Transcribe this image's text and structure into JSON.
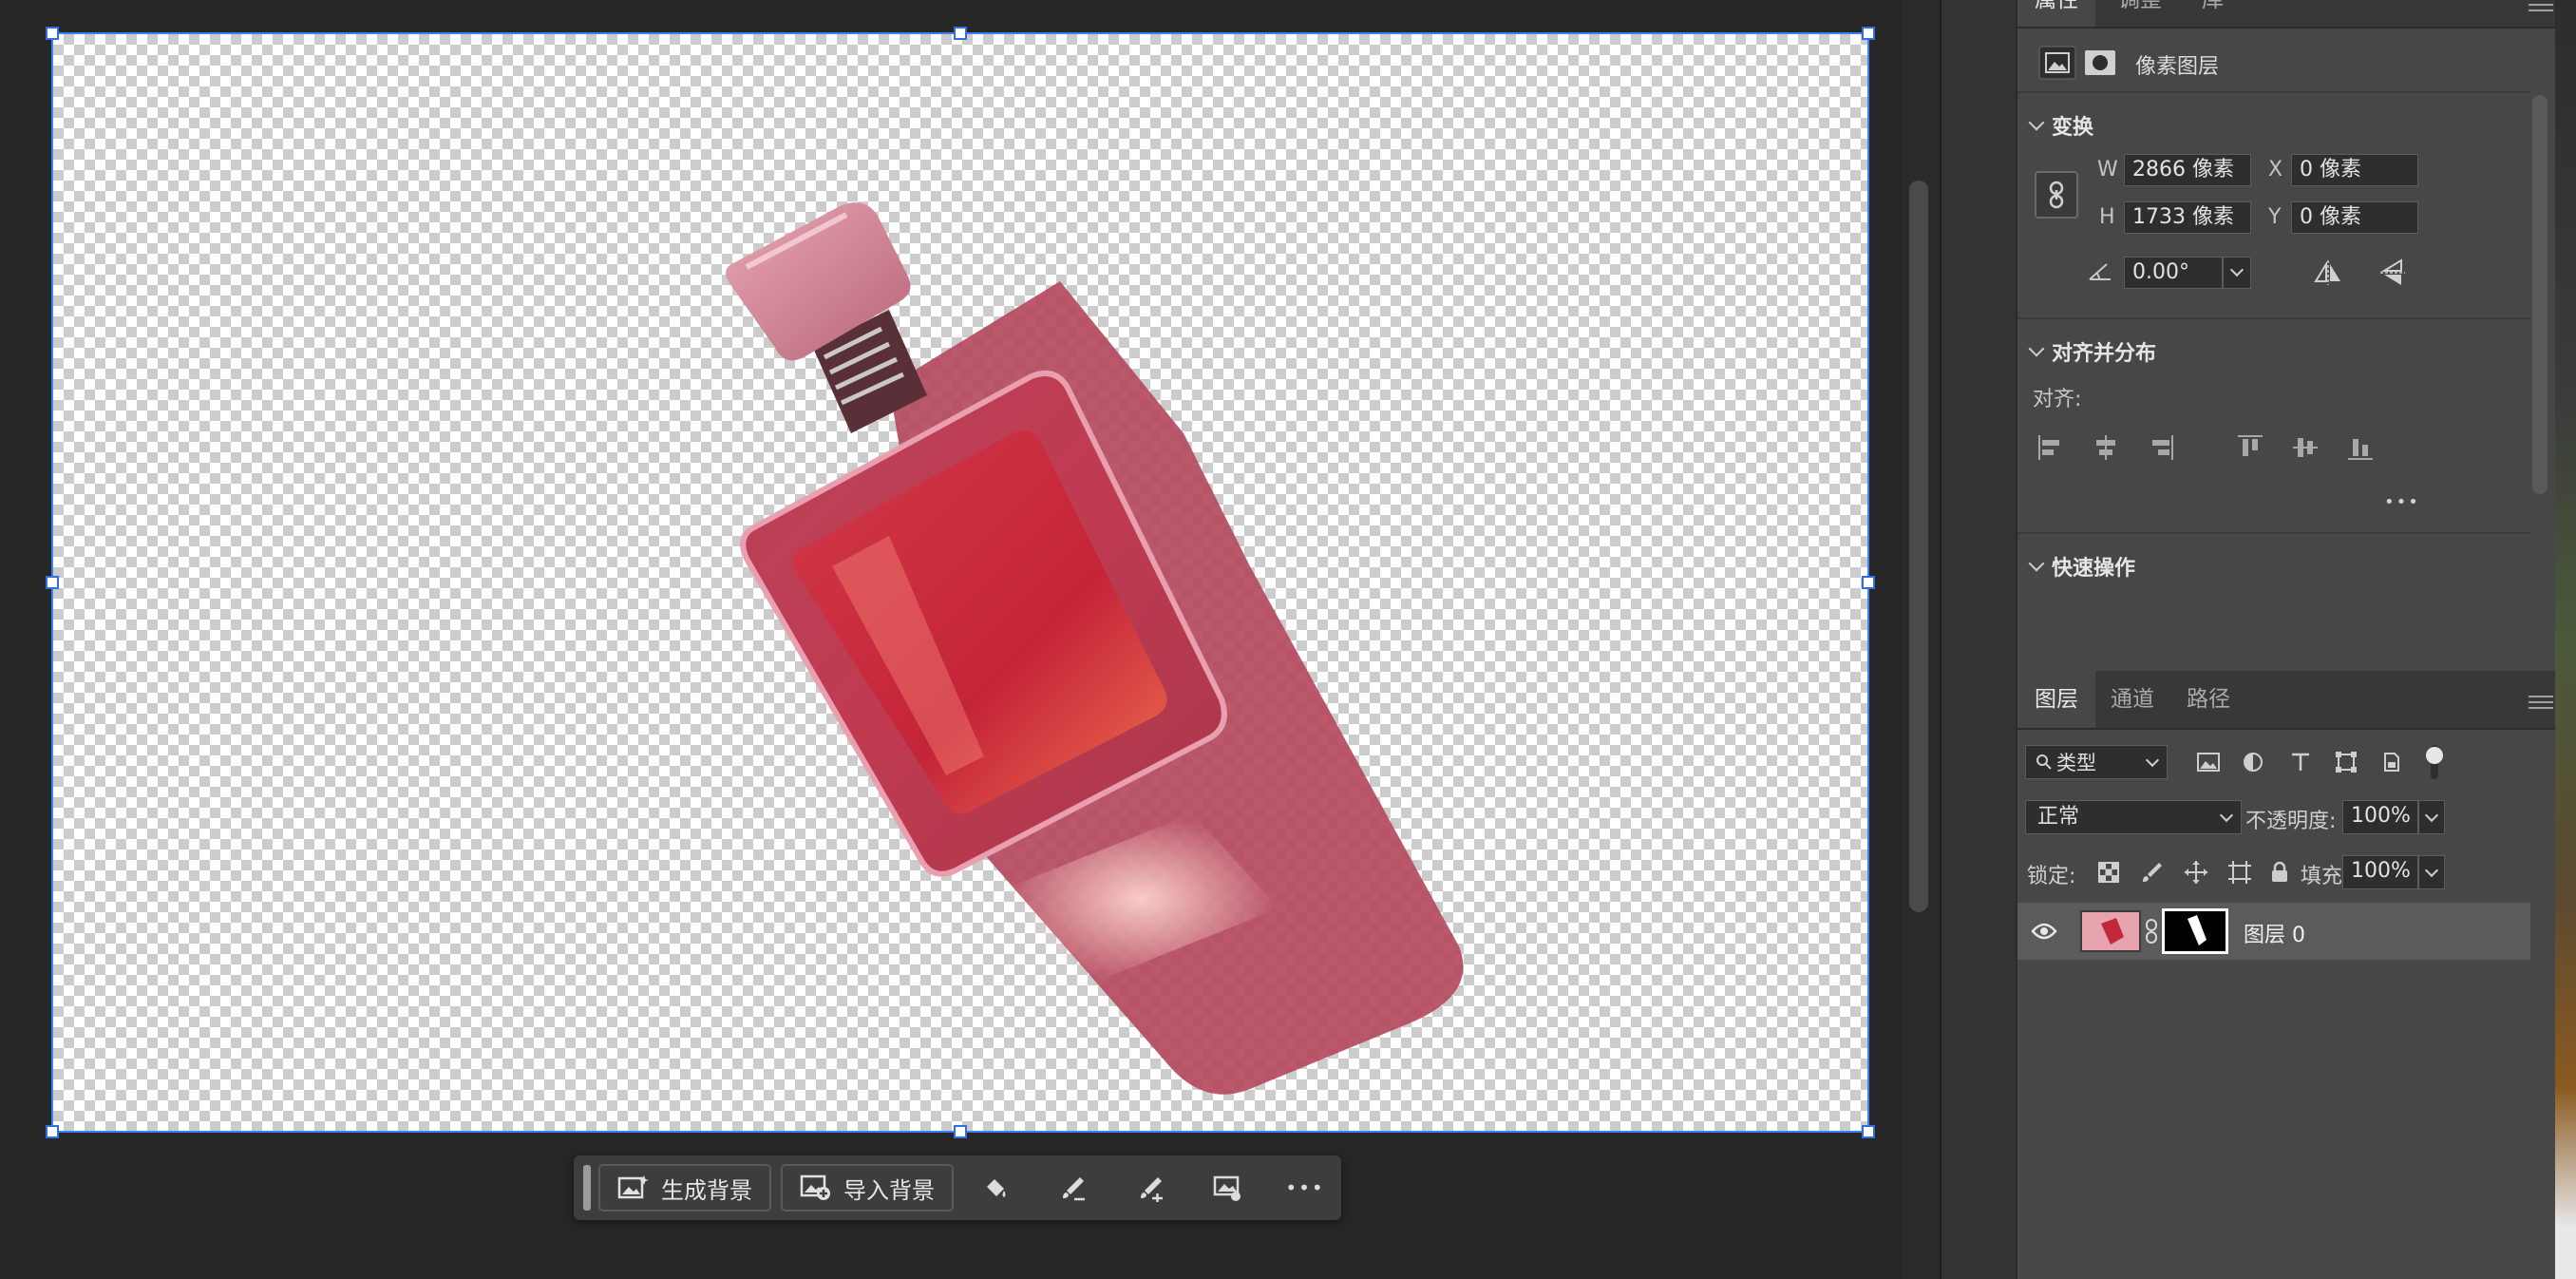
{
  "properties_panel": {
    "tabs": [
      "属性",
      "调整",
      "库"
    ],
    "active_tab": "属性",
    "layer_kind": "像素图层",
    "transform": {
      "title": "变换",
      "w_label": "W",
      "w_value": "2866 像素",
      "h_label": "H",
      "h_value": "1733 像素",
      "x_label": "X",
      "x_value": "0 像素",
      "y_label": "Y",
      "y_value": "0 像素",
      "angle_value": "0.00°"
    },
    "align": {
      "title": "对齐并分布",
      "label": "对齐:",
      "more": "•••"
    },
    "quick_actions": {
      "title": "快速操作"
    }
  },
  "layers_panel": {
    "tabs": [
      "图层",
      "通道",
      "路径"
    ],
    "active_tab": "图层",
    "filter_label": "类型",
    "blend_mode": "正常",
    "opacity_label": "不透明度:",
    "opacity_value": "100%",
    "lock_label": "锁定:",
    "fill_label": "填充:",
    "fill_value": "100%",
    "layers": [
      {
        "name": "图层 0",
        "visible": true
      }
    ]
  },
  "taskbar": {
    "generate_bg_label": "生成背景",
    "import_bg_label": "导入背景",
    "more_label": "•••"
  },
  "colors": {
    "accent": "#2f6fe0",
    "bottle_red": "#c8303f",
    "panel_bg": "#474747"
  }
}
